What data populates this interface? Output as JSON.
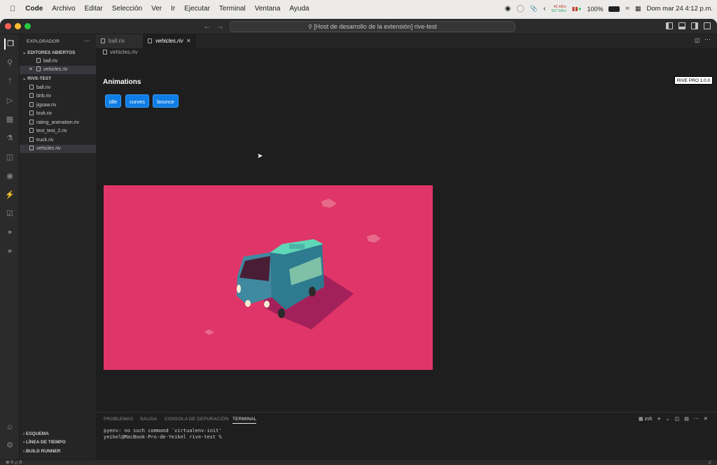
{
  "menubar": {
    "app": "Code",
    "items": [
      "Archivo",
      "Editar",
      "Selección",
      "Ver",
      "Ir",
      "Ejecutar",
      "Terminal",
      "Ventana",
      "Ayuda"
    ],
    "net_up": "42 kB/s",
    "net_down": "937 kB/s",
    "battery": "100%",
    "datetime": "Dom mar 24  4:12 p.m."
  },
  "titlebar": {
    "command_center": "[Host de desarrollo de la extensión] rive-test"
  },
  "sidebar": {
    "title": "EXPLORADOR",
    "open_editors_label": "EDITORES ABIERTOS",
    "open_editors": [
      {
        "name": "ball.riv"
      },
      {
        "name": "vehicles.riv"
      }
    ],
    "folder_label": "RIVE-TEST",
    "files": [
      "ball.riv",
      "birb.riv",
      "jigsaw.riv",
      "look.riv",
      "rating_animation.riv",
      "text_test_2.riv",
      "truck.riv",
      "vehicles.riv"
    ],
    "outline_label": "ESQUEMA",
    "timeline_label": "LÍNEA DE TIEMPO",
    "build_runner_label": "BUILD RUNNER"
  },
  "editor": {
    "tabs": [
      {
        "label": "ball.riv"
      },
      {
        "label": "vehicles.riv"
      }
    ],
    "breadcrumb": "vehicles.riv",
    "heading": "Animations",
    "buttons": [
      "idle",
      "curves",
      "bounce"
    ],
    "badge": "RIVE PRO 1.0.0",
    "canvas_color": "#e03568"
  },
  "panel": {
    "tabs": [
      "PROBLEMAS",
      "SALIDA",
      "CONSOLA DE DEPURACIÓN",
      "TERMINAL"
    ],
    "shell": "zsh",
    "lines": [
      "pyenv: no such command `virtualenv-init'",
      "yeikel@MacBook-Pro-de-Yeikel rive-test % "
    ]
  },
  "statusbar": {
    "errors": "0",
    "warnings": "0"
  }
}
